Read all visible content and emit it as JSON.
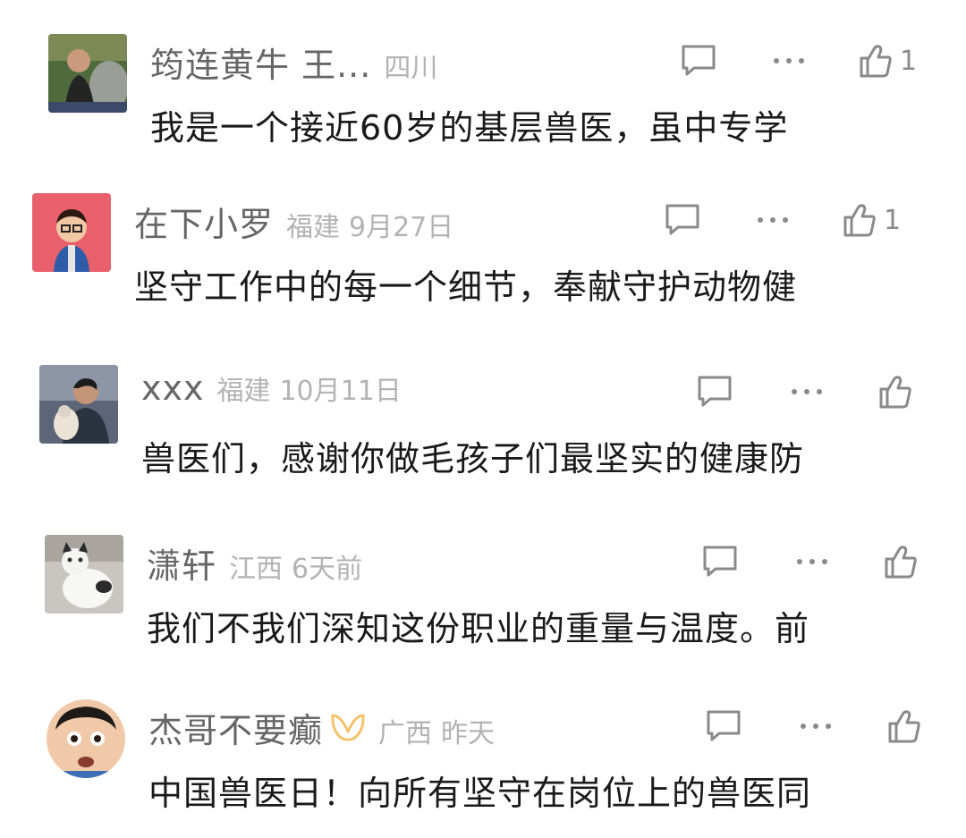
{
  "comments": [
    {
      "username": "筠连黄牛  王...",
      "region": "四川",
      "time": "",
      "text": "我是一个接近60岁的基层兽医，虽中专学",
      "likes": "1"
    },
    {
      "username": "在下小罗",
      "region": "福建",
      "time": "9月27日",
      "text": "坚守工作中的每一个细节，奉献守护动物健",
      "likes": "1"
    },
    {
      "username": "xxx",
      "region": "福建",
      "time": "10月11日",
      "text": "兽医们，感谢你做毛孩子们最坚实的健康防",
      "likes": ""
    },
    {
      "username": "潇轩",
      "region": "江西",
      "time": "6天前",
      "text": "我们不我们深知这份职业的重量与温度。前",
      "likes": ""
    },
    {
      "username": "杰哥不要癫",
      "region": "广西",
      "time": "昨天",
      "text": "中国兽医日！向所有坚守在岗位上的兽医同",
      "likes": ""
    }
  ],
  "icons": {
    "reply": "comment-bubble-icon",
    "more": "more-dots-icon",
    "like": "thumbs-up-icon",
    "vip": "vip-badge-icon"
  },
  "colors": {
    "icon": "#8a8a8a",
    "vip": "#f5c26b"
  }
}
